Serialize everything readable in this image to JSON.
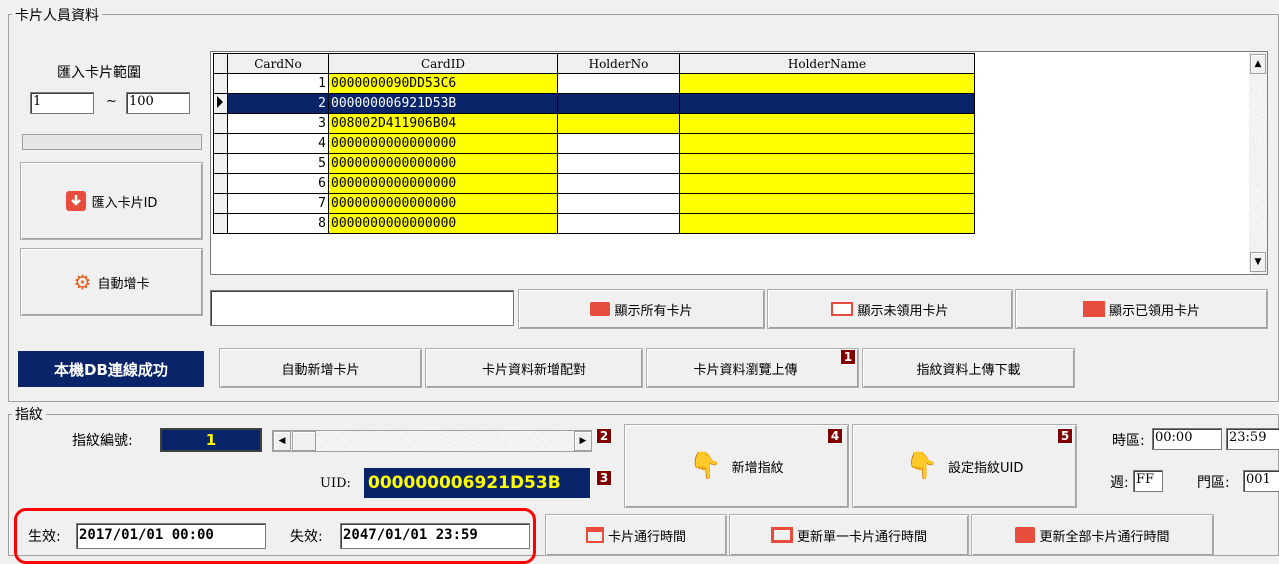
{
  "card_group": {
    "title": "卡片人員資料",
    "import_range_label": "匯入卡片範圍",
    "range_from": "1",
    "range_sep": "~",
    "range_to": "100",
    "import_button": "匯入卡片ID",
    "auto_add_button": "自動增卡",
    "columns": [
      "CardNo",
      "CardID",
      "HolderNo",
      "HolderName"
    ],
    "rows": [
      {
        "no": "1",
        "id": "0000000090DD53C6",
        "holder_no": "",
        "holder_name": ""
      },
      {
        "no": "2",
        "id": "000000006921D53B",
        "holder_no": "",
        "holder_name": ""
      },
      {
        "no": "3",
        "id": "008002D411906B04",
        "holder_no": "",
        "holder_name": ""
      },
      {
        "no": "4",
        "id": "0000000000000000",
        "holder_no": "",
        "holder_name": ""
      },
      {
        "no": "5",
        "id": "0000000000000000",
        "holder_no": "",
        "holder_name": ""
      },
      {
        "no": "6",
        "id": "0000000000000000",
        "holder_no": "",
        "holder_name": ""
      },
      {
        "no": "7",
        "id": "0000000000000000",
        "holder_no": "",
        "holder_name": ""
      },
      {
        "no": "8",
        "id": "0000000000000000",
        "holder_no": "",
        "holder_name": ""
      }
    ],
    "show_all": "顯示所有卡片",
    "show_unused": "顯示未領用卡片",
    "show_used": "顯示已領用卡片"
  },
  "toolbar": {
    "status": "本機DB連線成功",
    "auto_new_card": "自動新增卡片",
    "card_pair": "卡片資料新增配對",
    "card_browse_upload": "卡片資料瀏覽上傳",
    "fp_upload_download": "指紋資料上傳下載",
    "badge1": "1"
  },
  "fingerprint": {
    "title": "指紋",
    "fp_number_label": "指紋編號:",
    "fp_number": "1",
    "uid_label": "UID:",
    "uid_value": "000000006921D53B",
    "add_fp": "新增指紋",
    "set_fp_uid": "設定指紋UID",
    "badges": [
      "2",
      "3",
      "4",
      "5"
    ],
    "timezone_label": "時區:",
    "tz_start": "00:00",
    "tz_end": "23:59",
    "week_label": "週:",
    "week_value": "FF",
    "door_label": "門區:",
    "door_value": "001"
  },
  "validity": {
    "start_label": "生效:",
    "start_value": "2017/01/01 00:00",
    "end_label": "失效:",
    "end_value": "2047/01/01 23:59",
    "card_time": "卡片通行時間",
    "update_single": "更新單一卡片通行時間",
    "update_all": "更新全部卡片通行時間"
  },
  "colors": {
    "accent_dark": "#0a246a",
    "badge": "#800000",
    "highlight": "#ff0000",
    "icon_red": "#e74c3c"
  }
}
